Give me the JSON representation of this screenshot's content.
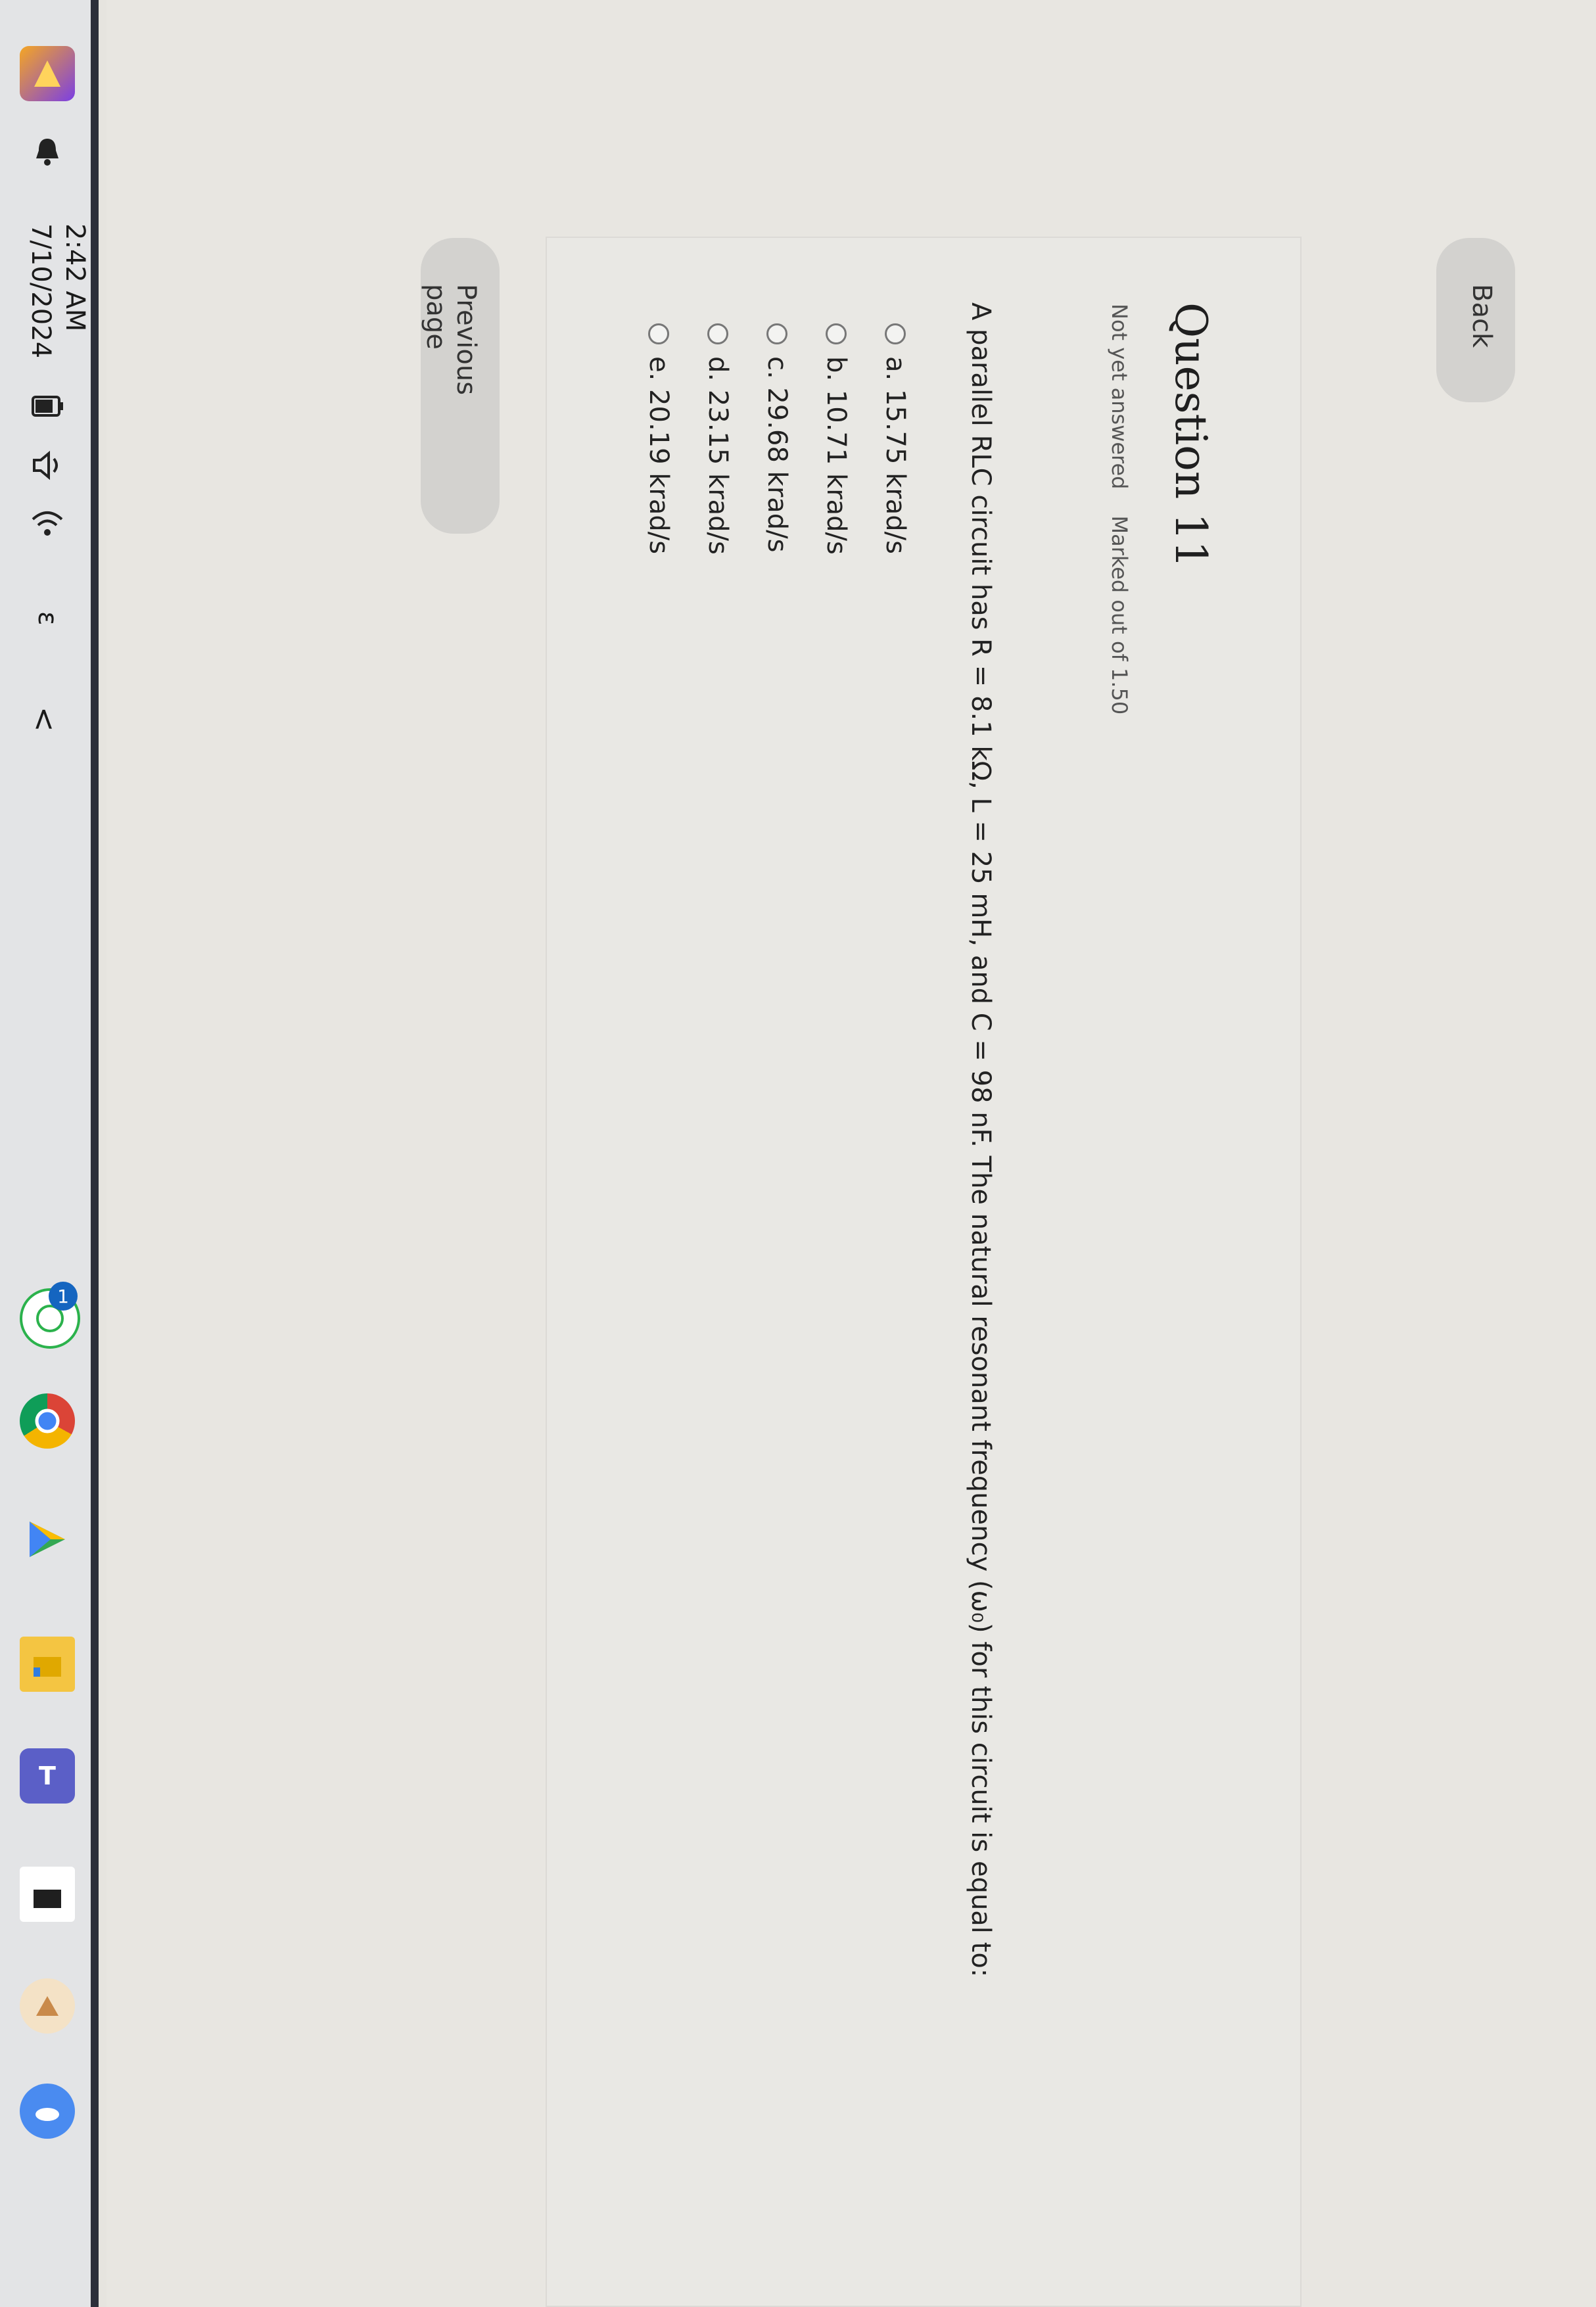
{
  "taskbar": {
    "time": "2:42 AM",
    "date": "7/10/2024",
    "chevron": "<",
    "language": "ε",
    "badge": "1"
  },
  "nav": {
    "back_label": "Back"
  },
  "question": {
    "title": "Question 11",
    "status": "Not yet answered",
    "marks": "Marked out of 1.50",
    "text": "A parallel RLC circuit has R = 8.1 kΩ, L = 25 mH, and C = 98 nF. The natural resonant frequency (ω₀) for this circuit is equal to:",
    "options": [
      "a. 15.75 krad/s",
      "b. 10.71 krad/s",
      "c. 29.68 krad/s",
      "d. 23.15 krad/s",
      "e. 20.19 krad/s"
    ]
  },
  "footer": {
    "previous_label": "Previous page"
  }
}
